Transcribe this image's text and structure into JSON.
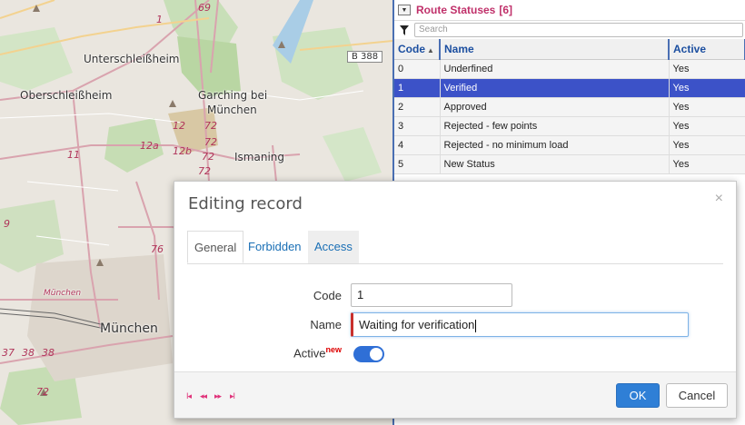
{
  "map": {
    "places": [
      "Unterschleißheim",
      "Oberschleißheim",
      "Garching bei",
      "München",
      "Ismaning",
      "München",
      "München"
    ],
    "road_numbers": [
      "69",
      "1",
      "12",
      "72",
      "72",
      "72",
      "72",
      "12a",
      "12b",
      "11",
      "76",
      "37",
      "38",
      "38",
      "72",
      "9"
    ],
    "road_badge": "B 388"
  },
  "panel": {
    "title": "Route Statuses",
    "count": "[6]",
    "search_placeholder": "Search",
    "columns": [
      "Code",
      "Name",
      "Active"
    ],
    "rows": [
      {
        "code": "0",
        "name": "Underfined",
        "active": "Yes"
      },
      {
        "code": "1",
        "name": "Verified",
        "active": "Yes"
      },
      {
        "code": "2",
        "name": "Approved",
        "active": "Yes"
      },
      {
        "code": "3",
        "name": "Rejected - few points",
        "active": "Yes"
      },
      {
        "code": "4",
        "name": "Rejected - no minimum load",
        "active": "Yes"
      },
      {
        "code": "5",
        "name": "New Status",
        "active": "Yes"
      }
    ],
    "selected_row": 1
  },
  "dialog": {
    "title": "Editing record",
    "close": "×",
    "tabs": [
      "General",
      "Forbidden",
      "Access"
    ],
    "fields": {
      "code_label": "Code",
      "code_value": "1",
      "name_label": "Name",
      "name_value": "Waiting for verification",
      "active_label": "Active",
      "active_badge": "new",
      "active_on": true
    },
    "nav": {
      "first": "I◂",
      "prev": "◂◂",
      "next": "▸▸",
      "last": "▸I"
    },
    "buttons": {
      "ok": "OK",
      "cancel": "Cancel"
    }
  },
  "colors": {
    "accent": "#2f7fd6",
    "selection": "#3c52c8",
    "panel_title": "#c0306a",
    "required": "#c9302c"
  }
}
